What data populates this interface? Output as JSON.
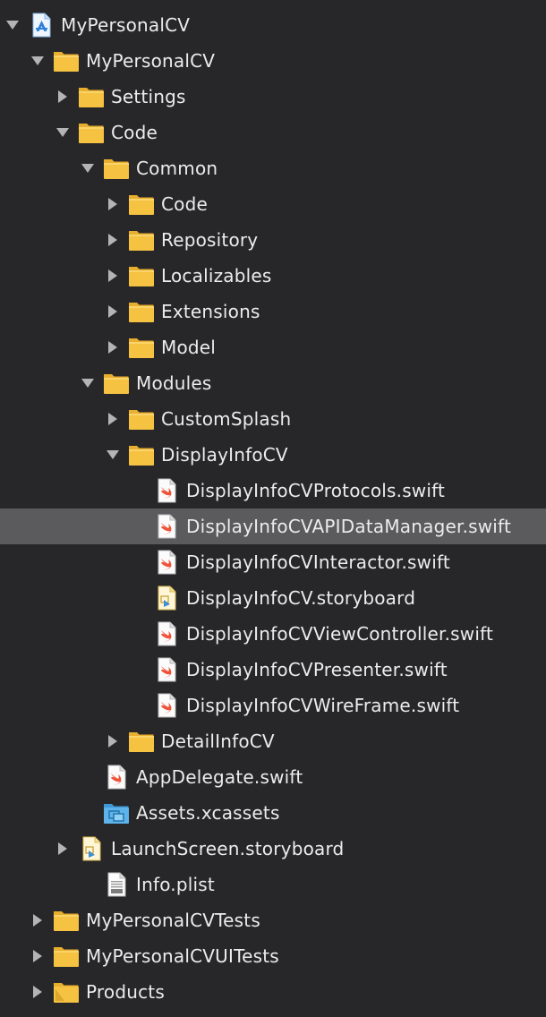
{
  "navigator": {
    "items": [
      {
        "label": "MyPersonalCV",
        "level": 0,
        "icon": "xcode-project-icon",
        "expanded": true,
        "has_children": true,
        "selected": false
      },
      {
        "label": "MyPersonalCV",
        "level": 1,
        "icon": "folder-icon",
        "expanded": true,
        "has_children": true,
        "selected": false
      },
      {
        "label": "Settings",
        "level": 2,
        "icon": "folder-icon",
        "expanded": false,
        "has_children": true,
        "selected": false
      },
      {
        "label": "Code",
        "level": 2,
        "icon": "folder-icon",
        "expanded": true,
        "has_children": true,
        "selected": false
      },
      {
        "label": "Common",
        "level": 3,
        "icon": "folder-icon",
        "expanded": true,
        "has_children": true,
        "selected": false
      },
      {
        "label": "Code",
        "level": 4,
        "icon": "folder-icon",
        "expanded": false,
        "has_children": true,
        "selected": false
      },
      {
        "label": "Repository",
        "level": 4,
        "icon": "folder-icon",
        "expanded": false,
        "has_children": true,
        "selected": false
      },
      {
        "label": "Localizables",
        "level": 4,
        "icon": "folder-icon",
        "expanded": false,
        "has_children": true,
        "selected": false
      },
      {
        "label": "Extensions",
        "level": 4,
        "icon": "folder-icon",
        "expanded": false,
        "has_children": true,
        "selected": false
      },
      {
        "label": "Model",
        "level": 4,
        "icon": "folder-icon",
        "expanded": false,
        "has_children": true,
        "selected": false
      },
      {
        "label": "Modules",
        "level": 3,
        "icon": "folder-icon",
        "expanded": true,
        "has_children": true,
        "selected": false
      },
      {
        "label": "CustomSplash",
        "level": 4,
        "icon": "folder-icon",
        "expanded": false,
        "has_children": true,
        "selected": false
      },
      {
        "label": "DisplayInfoCV",
        "level": 4,
        "icon": "folder-icon",
        "expanded": true,
        "has_children": true,
        "selected": false
      },
      {
        "label": "DisplayInfoCVProtocols.swift",
        "level": 5,
        "icon": "swift-file-icon",
        "expanded": false,
        "has_children": false,
        "selected": false
      },
      {
        "label": "DisplayInfoCVAPIDataManager.swift",
        "level": 5,
        "icon": "swift-file-icon",
        "expanded": false,
        "has_children": false,
        "selected": true
      },
      {
        "label": "DisplayInfoCVInteractor.swift",
        "level": 5,
        "icon": "swift-file-icon",
        "expanded": false,
        "has_children": false,
        "selected": false
      },
      {
        "label": "DisplayInfoCV.storyboard",
        "level": 5,
        "icon": "storyboard-file-icon",
        "expanded": false,
        "has_children": false,
        "selected": false
      },
      {
        "label": "DisplayInfoCVViewController.swift",
        "level": 5,
        "icon": "swift-file-icon",
        "expanded": false,
        "has_children": false,
        "selected": false
      },
      {
        "label": "DisplayInfoCVPresenter.swift",
        "level": 5,
        "icon": "swift-file-icon",
        "expanded": false,
        "has_children": false,
        "selected": false
      },
      {
        "label": "DisplayInfoCVWireFrame.swift",
        "level": 5,
        "icon": "swift-file-icon",
        "expanded": false,
        "has_children": false,
        "selected": false
      },
      {
        "label": "DetailInfoCV",
        "level": 4,
        "icon": "folder-icon",
        "expanded": false,
        "has_children": true,
        "selected": false
      },
      {
        "label": "AppDelegate.swift",
        "level": 3,
        "icon": "swift-file-icon",
        "expanded": false,
        "has_children": false,
        "selected": false
      },
      {
        "label": "Assets.xcassets",
        "level": 3,
        "icon": "asset-catalog-icon",
        "expanded": false,
        "has_children": false,
        "selected": false
      },
      {
        "label": "LaunchScreen.storyboard",
        "level": 2,
        "icon": "storyboard-file-icon",
        "expanded": false,
        "has_children": true,
        "selected": false
      },
      {
        "label": "Info.plist",
        "level": 3,
        "icon": "plist-file-icon",
        "expanded": false,
        "has_children": false,
        "selected": false
      },
      {
        "label": "MyPersonalCVTests",
        "level": 1,
        "icon": "folder-icon",
        "expanded": false,
        "has_children": true,
        "selected": false
      },
      {
        "label": "MyPersonalCVUITests",
        "level": 1,
        "icon": "folder-icon",
        "expanded": false,
        "has_children": true,
        "selected": false
      },
      {
        "label": "Products",
        "level": 1,
        "icon": "products-folder-icon",
        "expanded": false,
        "has_children": true,
        "selected": false
      }
    ]
  },
  "colors": {
    "background": "#272729",
    "selection": "#5b5b5e",
    "text": "#ececec",
    "disclosure": "#b4b4b6",
    "folder": "#f5c242",
    "swift": "#f05138",
    "asset_folder": "#5eb4ea"
  }
}
